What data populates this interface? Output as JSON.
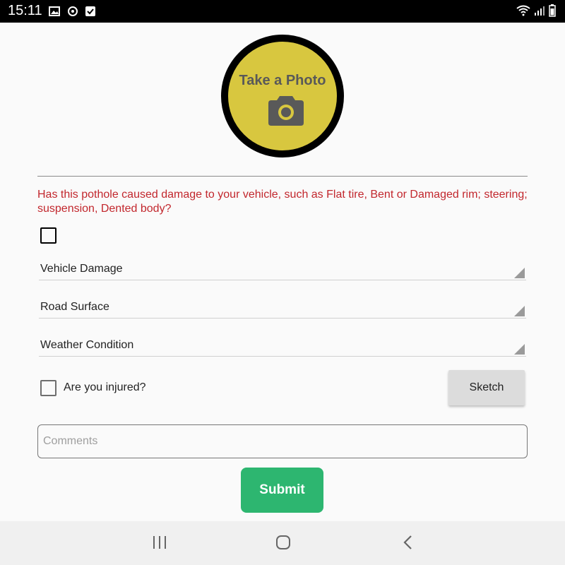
{
  "status_bar": {
    "time": "15:11",
    "left_icons": [
      "image-icon",
      "sync-icon",
      "checklist-icon"
    ],
    "right_icons": [
      "wifi-icon",
      "signal-icon",
      "battery-icon"
    ]
  },
  "photo_button": {
    "label": "Take a Photo",
    "icon": "camera-icon",
    "color": "#d8c73f"
  },
  "damage_question": "Has this pothole caused damage to your vehicle, such as Flat tire, Bent or Damaged rim; steering; suspension, Dented body?",
  "damage_checked": false,
  "spinners": {
    "vehicle_damage": "Vehicle Damage",
    "road_surface": "Road Surface",
    "weather_condition": "Weather Condition"
  },
  "injured": {
    "label": "Are you injured?",
    "checked": false
  },
  "sketch_button": "Sketch",
  "comments": {
    "placeholder": "Comments",
    "value": ""
  },
  "submit_button": "Submit",
  "nav_bar": {
    "icons": [
      "recent-apps-icon",
      "home-icon",
      "back-icon"
    ]
  },
  "colors": {
    "question_text": "#c2272d",
    "submit": "#2db670",
    "photo_fill": "#d8c73f"
  }
}
